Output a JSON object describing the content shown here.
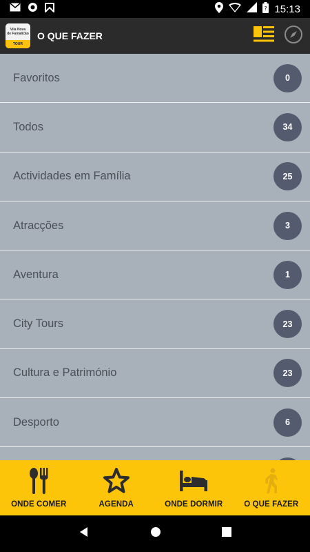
{
  "status_bar": {
    "time": "15:13",
    "left_icons": [
      "mail-icon",
      "sync-icon",
      "notification-icon"
    ],
    "right_icons": [
      "location-icon",
      "wifi-icon",
      "signal-icon",
      "battery-icon"
    ]
  },
  "app_bar": {
    "logo_line1": "Vila Nova",
    "logo_line2": "de Famalicão",
    "logo_brand": "TOUR",
    "title": "O QUE FAZER",
    "actions": [
      "list-view-icon",
      "compass-icon"
    ]
  },
  "list": {
    "items": [
      {
        "label": "Favoritos",
        "count": "0"
      },
      {
        "label": "Todos",
        "count": "34"
      },
      {
        "label": "Actividades em Família",
        "count": "25"
      },
      {
        "label": "Atracções",
        "count": "3"
      },
      {
        "label": "Aventura",
        "count": "1"
      },
      {
        "label": "City Tours",
        "count": "23"
      },
      {
        "label": "Cultura e Património",
        "count": "23"
      },
      {
        "label": "Desporto",
        "count": "6"
      },
      {
        "label": "",
        "count": ""
      }
    ]
  },
  "bottom_nav": {
    "tabs": [
      {
        "label": "ONDE COMER",
        "icon": "utensils-icon"
      },
      {
        "label": "AGENDA",
        "icon": "star-icon"
      },
      {
        "label": "ONDE DORMIR",
        "icon": "bed-icon"
      },
      {
        "label": "O QUE FAZER",
        "icon": "walking-icon",
        "active": true
      }
    ]
  },
  "colors": {
    "app_bar": "#2b2b2b",
    "accent": "#fcc509",
    "list_bg": "#a8b0ba",
    "badge_bg": "#555b6e"
  }
}
